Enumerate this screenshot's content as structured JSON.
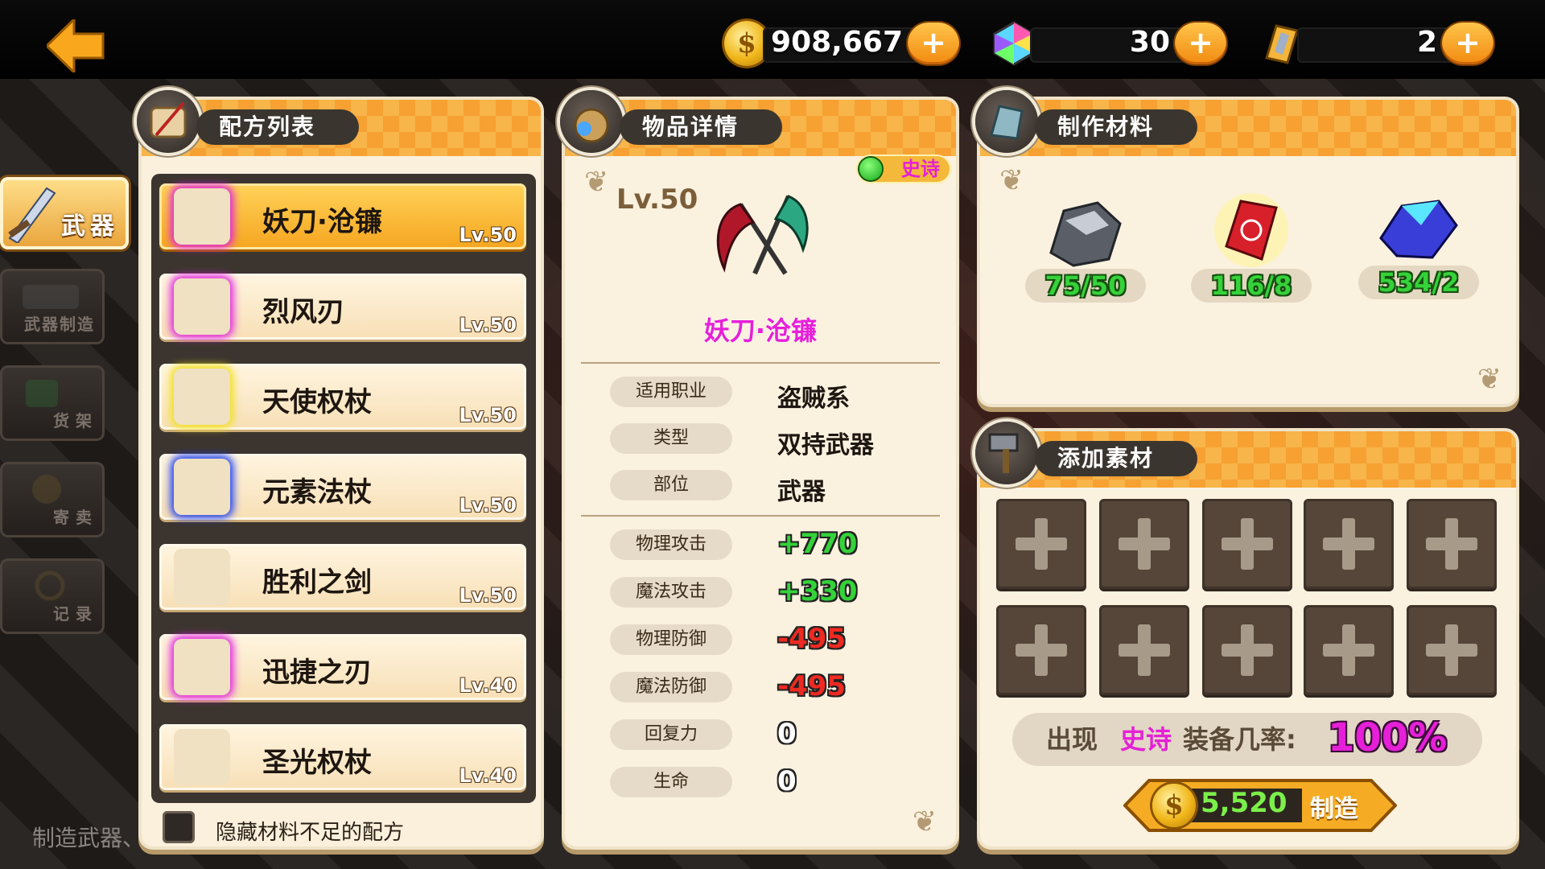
{
  "header": {
    "coins": "908,667",
    "gems": "30",
    "tickets": "2",
    "plus_label": "+"
  },
  "sidebar": {
    "tabs": [
      {
        "label": "武器"
      },
      {
        "label": "武器制造"
      },
      {
        "label": "货架"
      },
      {
        "label": "寄卖"
      },
      {
        "label": "记录"
      }
    ]
  },
  "bottom_hint": "制造武器、",
  "recipe_panel": {
    "title": "配方列表",
    "items": [
      {
        "name": "妖刀·沧镰",
        "level": "Lv.50",
        "glow": "#e01ee0"
      },
      {
        "name": "烈风刃",
        "level": "Lv.50",
        "glow": "#e01ee0"
      },
      {
        "name": "天使权杖",
        "level": "Lv.50",
        "glow": "#f2e01a"
      },
      {
        "name": "元素法杖",
        "level": "Lv.50",
        "glow": "#1a3df2"
      },
      {
        "name": "胜利之剑",
        "level": "Lv.50",
        "glow": "#ffffff"
      },
      {
        "name": "迅捷之刃",
        "level": "Lv.40",
        "glow": "#e01ee0"
      },
      {
        "name": "圣光权杖",
        "level": "Lv.40",
        "glow": "#ffffff"
      }
    ],
    "hide_label": "隐藏材料不足的配方"
  },
  "detail_panel": {
    "title": "物品详情",
    "rarity": "史诗",
    "level": "Lv.50",
    "item_name": "妖刀·沧镰",
    "info": [
      {
        "label": "适用职业",
        "value": "盗贼系"
      },
      {
        "label": "类型",
        "value": "双持武器"
      },
      {
        "label": "部位",
        "value": "武器"
      }
    ],
    "stats": [
      {
        "label": "物理攻击",
        "value": "+770"
      },
      {
        "label": "魔法攻击",
        "value": "+330"
      },
      {
        "label": "物理防御",
        "value": "-495"
      },
      {
        "label": "魔法防御",
        "value": "-495"
      },
      {
        "label": "回复力",
        "value": "0"
      },
      {
        "label": "生命",
        "value": "0"
      }
    ]
  },
  "materials_panel": {
    "title": "制作材料",
    "items": [
      {
        "icon": "silver-ore-icon",
        "count": "75/50"
      },
      {
        "icon": "red-rune-gem-icon",
        "count": "116/8"
      },
      {
        "icon": "blue-crystal-icon",
        "count": "534/2"
      }
    ]
  },
  "add_panel": {
    "title": "添加素材",
    "chance_prefix": "出现",
    "chance_rarity": "史诗",
    "chance_mid": "装备几率:",
    "chance_value": "100%",
    "craft_cost": "5,520",
    "craft_label": "制造"
  },
  "colors": {
    "epic": "#e620d8",
    "positive": "#35d23a",
    "negative": "#ee2a22",
    "accent_orange": "#f6a132"
  }
}
